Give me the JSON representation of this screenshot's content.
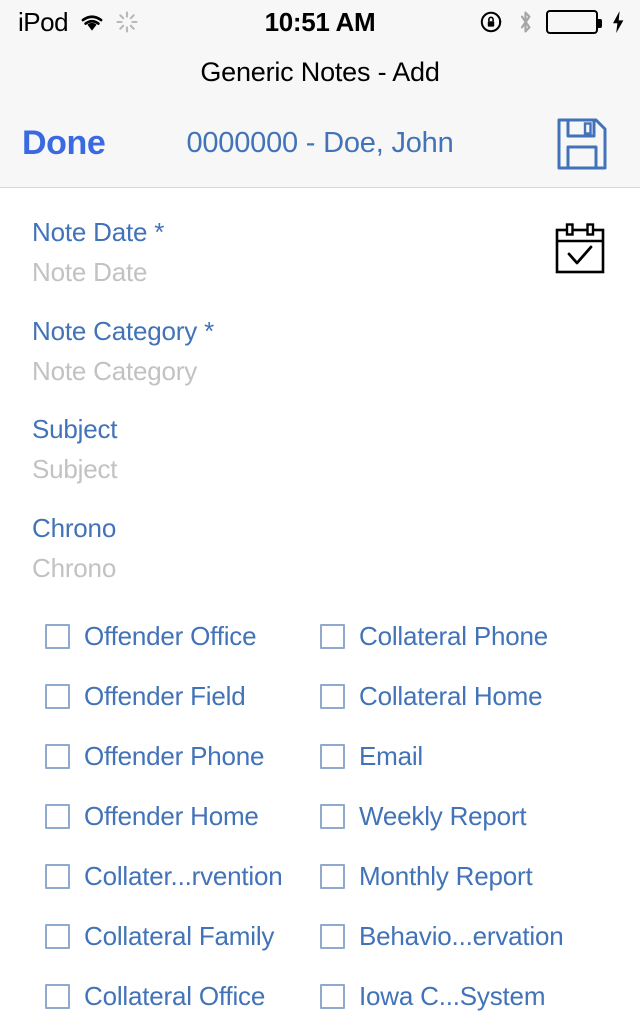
{
  "statusbar": {
    "carrier": "iPod",
    "wifi_icon": "wifi-icon",
    "activity_icon": "activity-spinner-icon",
    "time": "10:51 AM",
    "rotation_lock_icon": "rotation-lock-icon",
    "bluetooth_icon": "bluetooth-icon",
    "battery_icon": "battery-full-icon",
    "charging_icon": "lightning-bolt-icon",
    "battery_color": "#4cd764"
  },
  "titlebar": {
    "title": "Generic Notes - Add"
  },
  "navbar": {
    "done_label": "Done",
    "subject_title": "0000000 - Doe, John",
    "save_icon": "floppy-disk-save-icon",
    "accent_color": "#3b6ae0",
    "label_color": "#4273b8"
  },
  "form": {
    "calendar_icon": "calendar-check-icon",
    "fields": [
      {
        "label": "Note Date *",
        "placeholder": "Note Date",
        "value": ""
      },
      {
        "label": "Note Category *",
        "placeholder": "Note Category",
        "value": ""
      },
      {
        "label": "Subject",
        "placeholder": "Subject",
        "value": ""
      },
      {
        "label": "Chrono",
        "placeholder": "Chrono",
        "value": ""
      }
    ]
  },
  "checkboxes": {
    "column_left": [
      {
        "label": "Offender Office",
        "checked": false
      },
      {
        "label": "Offender Field",
        "checked": false
      },
      {
        "label": "Offender Phone",
        "checked": false
      },
      {
        "label": "Offender Home",
        "checked": false
      },
      {
        "label": "Collater...rvention",
        "checked": false
      },
      {
        "label": "Collateral Family",
        "checked": false
      },
      {
        "label": "Collateral Office",
        "checked": false
      }
    ],
    "column_right": [
      {
        "label": "Collateral Phone",
        "checked": false
      },
      {
        "label": "Collateral Home",
        "checked": false
      },
      {
        "label": "Email",
        "checked": false
      },
      {
        "label": "Weekly Report",
        "checked": false
      },
      {
        "label": "Monthly Report",
        "checked": false
      },
      {
        "label": "Behavio...ervation",
        "checked": false
      },
      {
        "label": "Iowa C...System",
        "checked": false
      }
    ]
  }
}
